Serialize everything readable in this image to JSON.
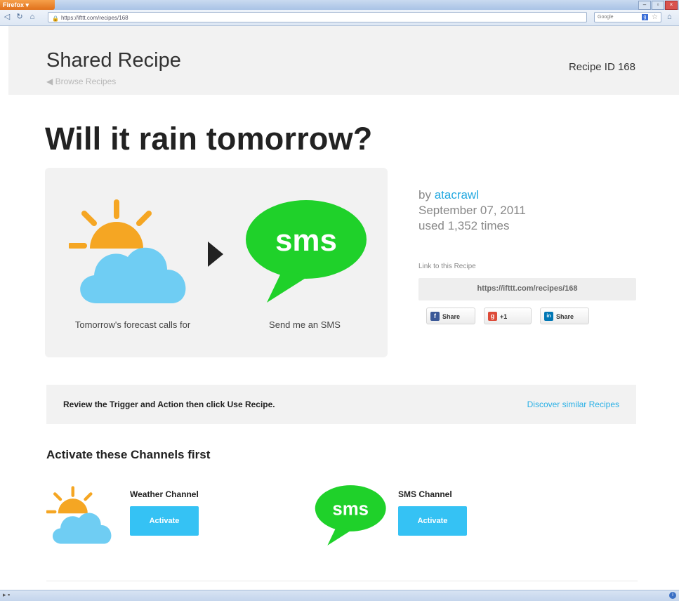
{
  "browser": {
    "menu_button": "Firefox ▾",
    "url": "https://ifttt.com/recipes/168",
    "search_placeholder": "Google",
    "window_controls": [
      "–",
      "▫",
      "×"
    ]
  },
  "header": {
    "title": "Shared Recipe",
    "back_link": "◀ Browse Recipes",
    "recipe_id": "Recipe ID 168"
  },
  "recipe": {
    "headline": "Will it rain tomorrow?",
    "trigger_caption": "Tomorrow's forecast calls for",
    "action_caption": "Send me an SMS",
    "sms_icon_text": "sms",
    "author_prefix": "by ",
    "author": "atacrawl",
    "date": "September 07, 2011",
    "usage": "used 1,352 times",
    "link_label": "Link to this Recipe",
    "link_url": "https://ifttt.com/recipes/168",
    "share_buttons": [
      {
        "label": "Share",
        "icon": "facebook-icon",
        "glyph": "f",
        "color": "#3b5998"
      },
      {
        "label": "+1",
        "icon": "google-plus-icon",
        "glyph": "g",
        "color": "#dd4b39"
      },
      {
        "label": "Share",
        "icon": "linkedin-icon",
        "glyph": "in",
        "color": "#0077b5"
      }
    ]
  },
  "review": {
    "text": "Review the Trigger and Action then click Use Recipe.",
    "discover_link": "Discover similar Recipes"
  },
  "channels": {
    "title": "Activate these Channels first",
    "items": [
      {
        "name": "Weather Channel",
        "button": "Activate",
        "icon": "weather-icon"
      },
      {
        "name": "SMS Channel",
        "button": "Activate",
        "icon": "sms-icon",
        "icon_text": "sms"
      }
    ]
  },
  "colors": {
    "accent_blue": "#35c2f4",
    "link_blue": "#22a8e0",
    "sms_green": "#1fd12a",
    "sun_orange": "#f5a623",
    "cloud_blue": "#6fcdf3"
  }
}
